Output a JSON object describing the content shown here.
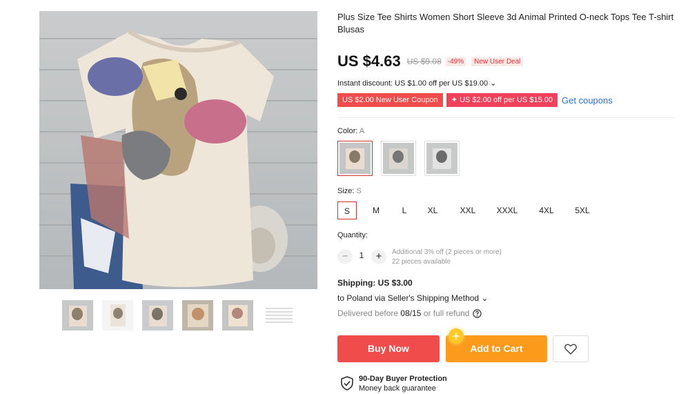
{
  "product": {
    "title": "Plus Size Tee Shirts Women Short Sleeve 3d Animal Printed O-neck Tops Tee T-shirt Blusas"
  },
  "price": {
    "current": "US $4.63",
    "original": "US $9.08",
    "discount": "-49%",
    "deal_tag": "New User Deal"
  },
  "instant_discount": "Instant discount: US $1.00 off per US $19.00",
  "coupons": {
    "coupon1": "US $2.00 New User Coupon",
    "coupon2": "US $2.00 off per US $15.00",
    "get_coupons": "Get coupons"
  },
  "color": {
    "label": "Color:",
    "selected": "A"
  },
  "size": {
    "label": "Size:",
    "selected": "S",
    "options": [
      "S",
      "M",
      "L",
      "XL",
      "XXL",
      "XXXL",
      "4XL",
      "5XL"
    ]
  },
  "quantity": {
    "label": "Quantity:",
    "minus": "−",
    "plus": "+",
    "value": "1",
    "note1": "Additional 3% off (2 pieces or more)",
    "note2": "22 pieces available"
  },
  "shipping": {
    "title": "Shipping: US $3.00",
    "line": "to Poland via Seller's Shipping Method",
    "delivered_prefix": "Delivered before",
    "delivered_date": "08/15",
    "delivered_suffix": "or full refund"
  },
  "actions": {
    "buy_now": "Buy Now",
    "add_to_cart": "Add to Cart"
  },
  "protection": {
    "title": "90-Day Buyer Protection",
    "subtitle": "Money back guarantee"
  },
  "colors": {
    "buy_bg": "#f04c4c",
    "cart_bg": "#fc9a1b",
    "link": "#2a6fdb",
    "selected_border": "#d23030"
  }
}
